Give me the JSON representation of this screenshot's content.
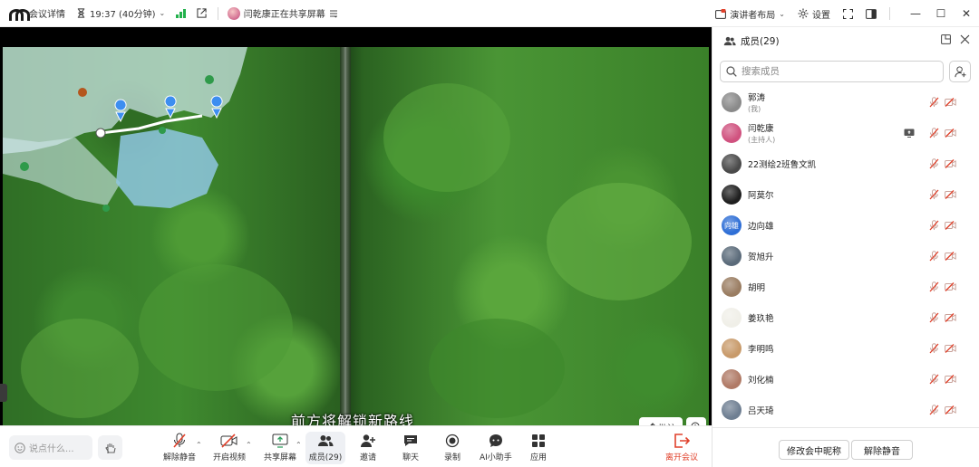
{
  "topbar": {
    "meeting_info": "会议详情",
    "time": "19:37 (40分钟)",
    "sharing_status": "闫乾康正在共享屏幕",
    "speaker_layout": "演讲者布局",
    "settings": "设置"
  },
  "video": {
    "subtitle": "前方将解锁新路线",
    "annotate": "批注"
  },
  "toolbar": {
    "chat_placeholder": "说点什么...",
    "unmute": "解除静音",
    "start_video": "开启视频",
    "share_screen": "共享屏幕",
    "members": "成员(29)",
    "invite": "邀请",
    "chat": "聊天",
    "record": "录制",
    "ai_assistant": "AI小助手",
    "apps": "应用",
    "leave": "离开会议"
  },
  "panel": {
    "title": "成员(29)",
    "search_placeholder": "搜索成员",
    "members": [
      {
        "name": "郭涛",
        "role": "(我)",
        "avatar_color": "#8a8a8a"
      },
      {
        "name": "闫乾康",
        "role": "(主持人)",
        "avatar_color": "#d0527f"
      },
      {
        "name": "22测绘2班鲁文凯",
        "role": "",
        "avatar_color": "#4a4a4a"
      },
      {
        "name": "阿莫尔",
        "role": "",
        "avatar_color": "#1f1f1f"
      },
      {
        "name": "边向雄",
        "role": "",
        "avatar_color": "#2f6fd6",
        "avatar_text": "向雄"
      },
      {
        "name": "贺旭升",
        "role": "",
        "avatar_color": "#5b6b7a"
      },
      {
        "name": "胡明",
        "role": "",
        "avatar_color": "#9a7d62"
      },
      {
        "name": "姜玖艳",
        "role": "",
        "avatar_color": "#f0efe8"
      },
      {
        "name": "李明鸣",
        "role": "",
        "avatar_color": "#c89a6a"
      },
      {
        "name": "刘化楠",
        "role": "",
        "avatar_color": "#b07a66"
      },
      {
        "name": "吕天琦",
        "role": "",
        "avatar_color": "#6f7f92"
      }
    ],
    "rename_button": "修改会中昵称",
    "unmute_all_button": "解除静音"
  },
  "colors": {
    "accent": "#2f6fd6",
    "muted_red": "#e0412b",
    "signal_green": "#22b14c"
  }
}
